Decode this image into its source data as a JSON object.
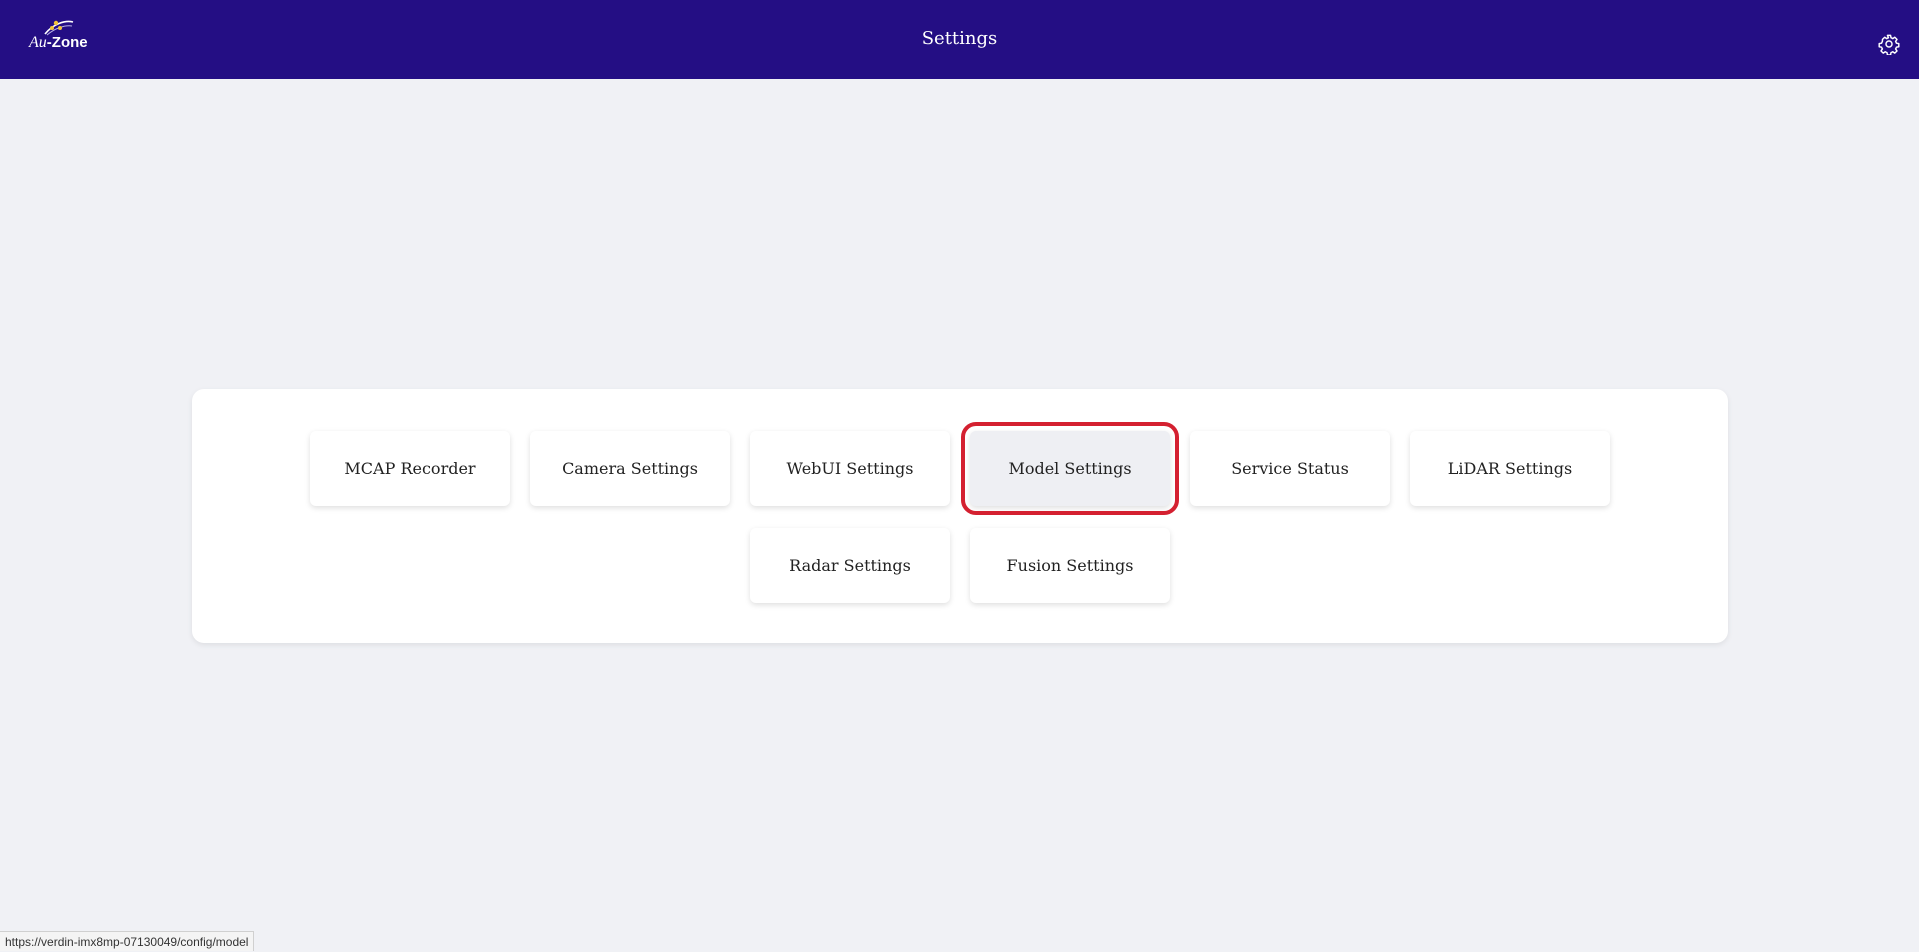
{
  "header": {
    "logo_prefix": "Au",
    "logo_suffix": "-Zone",
    "title": "Settings",
    "settings_icon": "gear-icon",
    "background_color": "#240e84"
  },
  "menu": {
    "items": [
      {
        "label": "MCAP Recorder",
        "selected": false
      },
      {
        "label": "Camera Settings",
        "selected": false
      },
      {
        "label": "WebUI Settings",
        "selected": false
      },
      {
        "label": "Model Settings",
        "selected": true
      },
      {
        "label": "Service Status",
        "selected": false
      },
      {
        "label": "LiDAR Settings",
        "selected": false
      },
      {
        "label": "Radar Settings",
        "selected": false
      },
      {
        "label": "Fusion Settings",
        "selected": false
      }
    ],
    "highlight_color": "#d42030"
  },
  "status_bar": {
    "url": "https://verdin-imx8mp-07130049/config/model"
  }
}
